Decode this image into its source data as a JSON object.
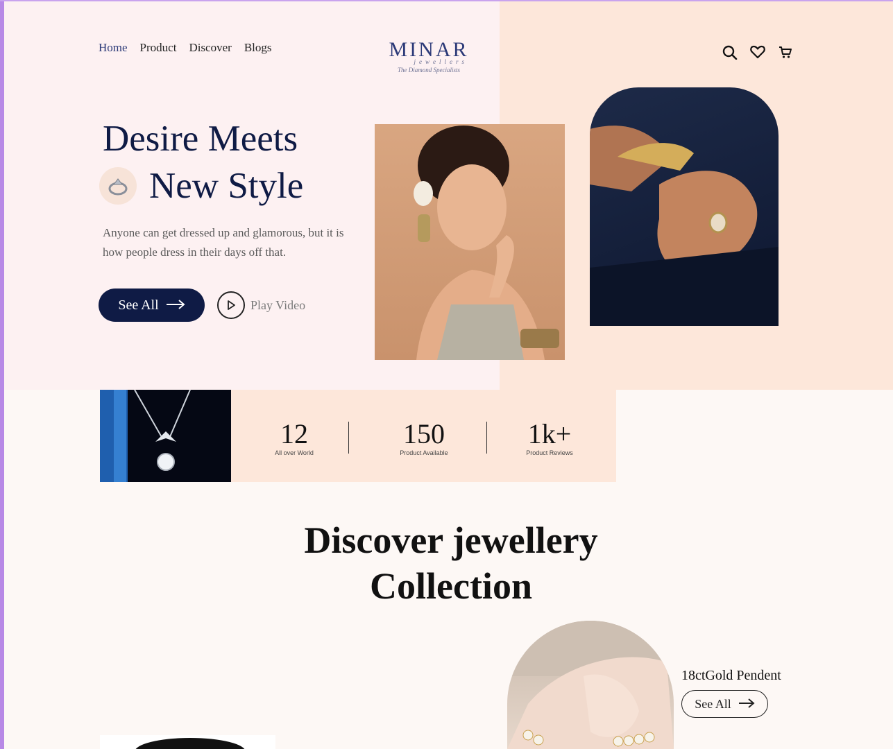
{
  "nav": {
    "links": [
      "Home",
      "Product",
      "Discover",
      "Blogs"
    ],
    "active_index": 0
  },
  "logo": {
    "brand": "MINAR",
    "sub": "jewellers",
    "tagline": "The Diamond Specialists"
  },
  "icons": [
    "search-icon",
    "heart-icon",
    "cart-icon"
  ],
  "hero": {
    "title_line1": "Desire Meets",
    "title_line2": "New Style",
    "description": "Anyone can get dressed up and glamorous, but it is how people dress in their days off that.",
    "primary_button": "See All",
    "secondary_button": "Play Video"
  },
  "stats": [
    {
      "value": "12",
      "label": "All over World"
    },
    {
      "value": "150",
      "label": "Product Available"
    },
    {
      "value": "1k+",
      "label": "Product Reviews"
    }
  ],
  "discover": {
    "title_line1": "Discover jewellery",
    "title_line2": "Collection"
  },
  "product": {
    "name": "18ctGold Pendent",
    "button": "See All"
  },
  "colors": {
    "accent": "#0f1b45",
    "brand": "#2c3a78",
    "hero_left_bg": "#fdf1f2",
    "hero_right_bg": "#fde7da",
    "page_bg": "#fdf8f5"
  }
}
